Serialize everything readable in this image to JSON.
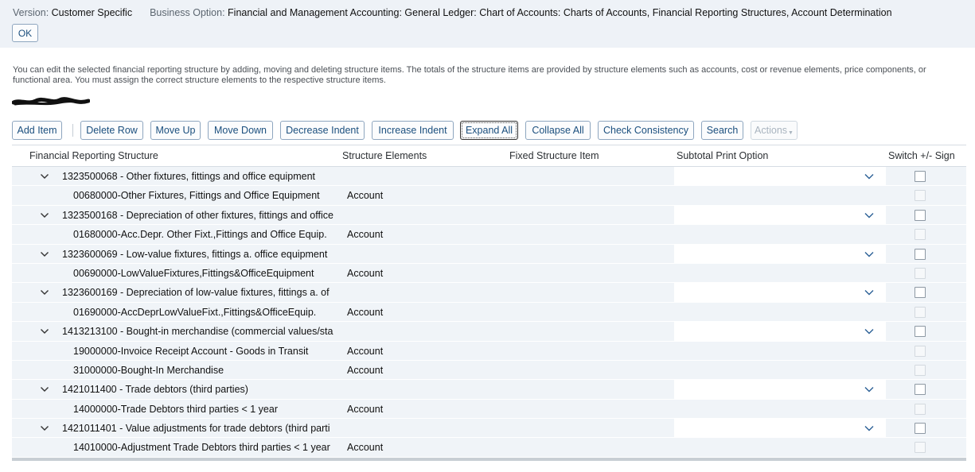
{
  "header": {
    "version_label": "Version:",
    "version_value": "Customer Specific",
    "business_option_label": "Business Option:",
    "business_option_value": "Financial and Management Accounting: General Ledger: Chart of Accounts: Charts of Accounts, Financial Reporting Structures, Account Determination",
    "ok_label": "OK"
  },
  "description": "You can edit the selected financial reporting structure by adding, moving and deleting structure items. The totals of the structure items are provided by structure elements such as accounts, cost or revenue elements, price components, or functional area. You must assign the correct structure elements to the respective structure items.",
  "toolbar": {
    "add_item": "Add Item",
    "delete_row": "Delete Row",
    "move_up": "Move Up",
    "move_down": "Move Down",
    "decrease_indent": "Decrease Indent",
    "increase_indent": "Increase Indent",
    "expand_all": "Expand All",
    "collapse_all": "Collapse All",
    "check_consistency": "Check Consistency",
    "search": "Search",
    "actions": "Actions"
  },
  "table": {
    "columns": {
      "financial_reporting_structure": "Financial Reporting Structure",
      "structure_elements": "Structure Elements",
      "fixed_structure_item": "Fixed Structure Item",
      "subtotal_print_option": "Subtotal Print Option",
      "switch_sign": "Switch +/- Sign"
    },
    "rows": [
      {
        "name": "1323500068 - Other fixtures, fittings and office equipment",
        "element": ""
      },
      {
        "name": "00680000-Other Fixtures, Fittings and Office Equipment",
        "element": "Account"
      },
      {
        "name": "1323500168 - Depreciation of other fixtures, fittings and office",
        "element": ""
      },
      {
        "name": "01680000-Acc.Depr. Other Fixt.,Fittings and Office Equip.",
        "element": "Account"
      },
      {
        "name": "1323600069 - Low-value fixtures, fittings a. office equipment",
        "element": ""
      },
      {
        "name": "00690000-LowValueFixtures,Fittings&OfficeEquipment",
        "element": "Account"
      },
      {
        "name": "1323600169 - Depreciation of low-value fixtures, fittings a. of",
        "element": ""
      },
      {
        "name": "01690000-AccDeprLowValueFixt.,Fittings&OfficeEquip.",
        "element": "Account"
      },
      {
        "name": "1413213100 - Bought-in merchandise (commercial values/sta",
        "element": ""
      },
      {
        "name": "19000000-Invoice Receipt Account - Goods in Transit",
        "element": "Account"
      },
      {
        "name": "31000000-Bought-In Merchandise",
        "element": "Account"
      },
      {
        "name": "1421011400 - Trade debtors (third parties)",
        "element": ""
      },
      {
        "name": "14000000-Trade Debtors third parties < 1 year",
        "element": "Account"
      },
      {
        "name": "1421011401 - Value adjustments for trade debtors (third parti",
        "element": ""
      },
      {
        "name": "14010000-Adjustment Trade Debtors third parties < 1 year",
        "element": "Account"
      }
    ]
  },
  "colors": {
    "header_bg": "#eef2f7",
    "row_bg": "#f0f4f8",
    "button_text": "#1b4f7e",
    "button_border": "#8ea6bf",
    "chevron": "#2a5f95"
  },
  "icons": {
    "expand": "chevron-down-icon",
    "dropdown": "chevron-down-icon",
    "checkbox": "checkbox-icon"
  }
}
